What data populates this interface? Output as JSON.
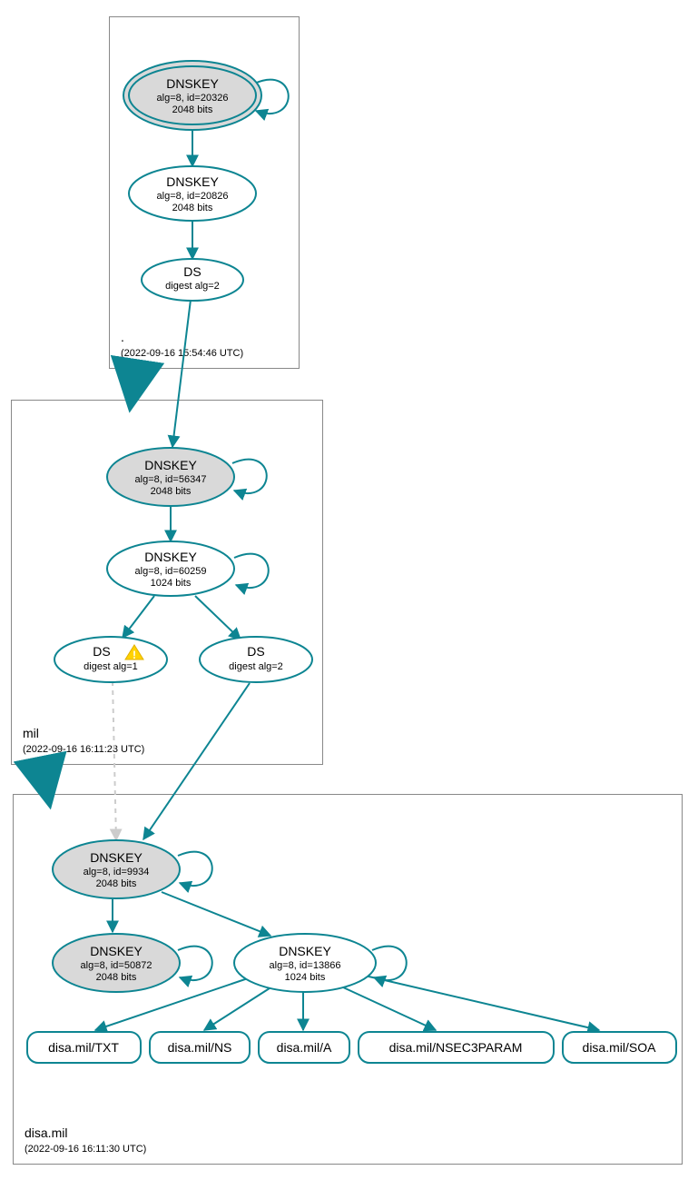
{
  "teal": "#0d8592",
  "grey_fill": "#d9d9d9",
  "dashed_grey": "#cccccc",
  "zones": {
    "root": {
      "name": ".",
      "ts": "(2022-09-16 15:54:46 UTC)",
      "dnskey1": {
        "title": "DNSKEY",
        "l1": "alg=8, id=20326",
        "l2": "2048 bits"
      },
      "dnskey2": {
        "title": "DNSKEY",
        "l1": "alg=8, id=20826",
        "l2": "2048 bits"
      },
      "ds1": {
        "title": "DS",
        "l1": "digest alg=2"
      }
    },
    "mil": {
      "name": "mil",
      "ts": "(2022-09-16 16:11:23 UTC)",
      "dnskey1": {
        "title": "DNSKEY",
        "l1": "alg=8, id=56347",
        "l2": "2048 bits"
      },
      "dnskey2": {
        "title": "DNSKEY",
        "l1": "alg=8, id=60259",
        "l2": "1024 bits"
      },
      "ds_warn": {
        "title": "DS",
        "l1": "digest alg=1"
      },
      "ds2": {
        "title": "DS",
        "l1": "digest alg=2"
      }
    },
    "disa": {
      "name": "disa.mil",
      "ts": "(2022-09-16 16:11:30 UTC)",
      "dnskey1": {
        "title": "DNSKEY",
        "l1": "alg=8, id=9934",
        "l2": "2048 bits"
      },
      "dnskey2": {
        "title": "DNSKEY",
        "l1": "alg=8, id=50872",
        "l2": "2048 bits"
      },
      "dnskey3": {
        "title": "DNSKEY",
        "l1": "alg=8, id=13866",
        "l2": "1024 bits"
      },
      "rr": {
        "txt": "disa.mil/TXT",
        "ns": "disa.mil/NS",
        "a": "disa.mil/A",
        "nsec3": "disa.mil/NSEC3PARAM",
        "soa": "disa.mil/SOA"
      }
    }
  }
}
